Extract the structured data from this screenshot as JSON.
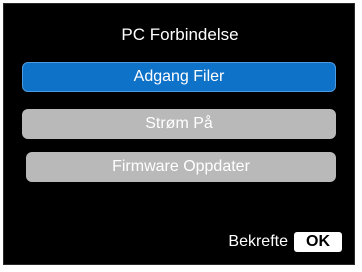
{
  "screen": {
    "title": "PC Forbindelse"
  },
  "menu": {
    "items": [
      {
        "label": "Adgang Filer",
        "selected": true
      },
      {
        "label": "Strøm På",
        "selected": false
      },
      {
        "label": "Firmware Oppdater",
        "selected": false
      }
    ]
  },
  "footer": {
    "confirm_label": "Bekrefte",
    "ok_key": "OK"
  },
  "colors": {
    "background": "#000000",
    "selected": "#0f72c9",
    "unselected": "#b9b9b9",
    "text": "#ffffff"
  }
}
